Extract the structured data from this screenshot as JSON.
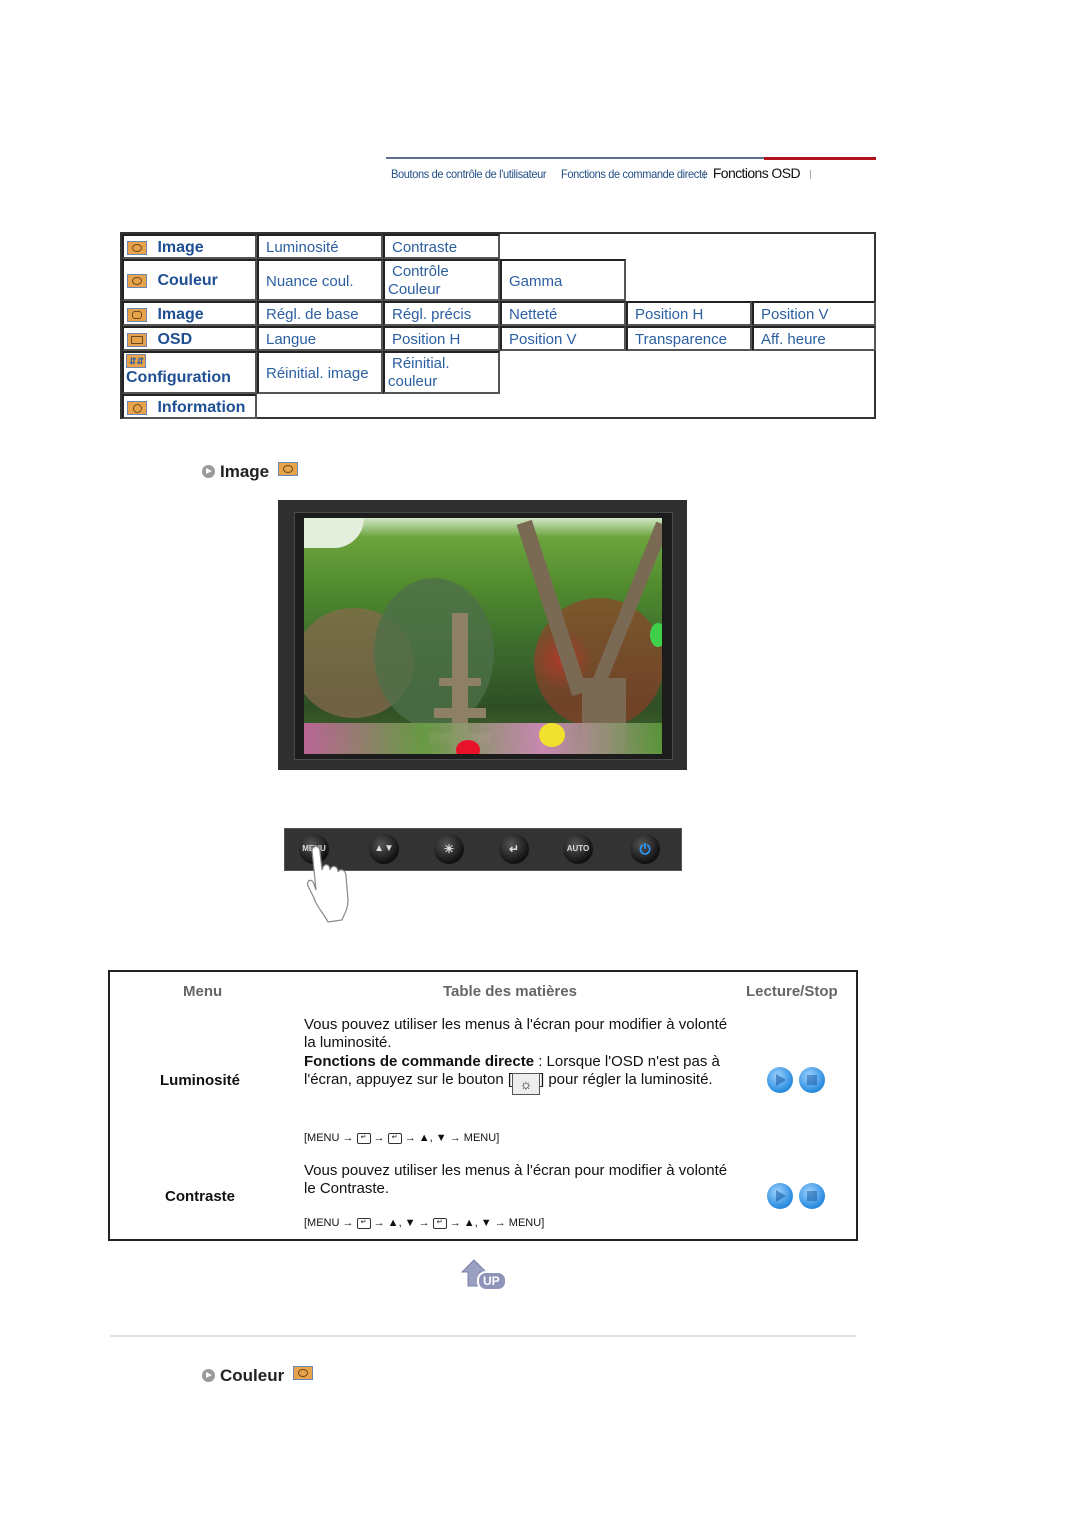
{
  "topnav": {
    "links": [
      "Boutons de contrôle de l'utilisateur",
      "Fonctions de commande directe"
    ],
    "active": "Fonctions OSD",
    "active_color": "#b0131d"
  },
  "menu_table": {
    "rows": [
      {
        "header": "Image",
        "icon": "image-icon",
        "items": [
          "Luminosité",
          "Contraste"
        ]
      },
      {
        "header": "Couleur",
        "icon": "color-icon",
        "items": [
          "Nuance coul.",
          "Contrôle Couleur",
          "Gamma"
        ]
      },
      {
        "header": "Image",
        "icon": "geometry-icon",
        "items": [
          "Régl. de base",
          "Régl. précis",
          "Netteté",
          "Position H",
          "Position V"
        ]
      },
      {
        "header": "OSD",
        "icon": "osd-icon",
        "items": [
          "Langue",
          "Position H",
          "Position V",
          "Transparence",
          "Aff. heure"
        ]
      },
      {
        "header": "Configuration",
        "icon": "setup-icon",
        "items": [
          "Réinitial. image",
          "Réinitial. couleur"
        ]
      },
      {
        "header": "Information",
        "icon": "information-icon",
        "items": []
      }
    ]
  },
  "section_image": {
    "title": "Image"
  },
  "monitor_buttons": [
    "MENU",
    "▲▼",
    "☀",
    "↵",
    "AUTO",
    "⏻"
  ],
  "content_table": {
    "headers": {
      "menu": "Menu",
      "contents": "Table des matières",
      "play": "Lecture/Stop"
    },
    "rows": [
      {
        "label": "Luminosité",
        "desc1": "Vous pouvez utiliser les menus à l'écran pour modifier à volonté la luminosité.",
        "desc_bold": "Fonctions de commande directe",
        "desc2_a": " : Lorsque l'OSD n'est pas à l'écran, appuyez sur le bouton [",
        "desc2_b": "] pour régler la luminosité.",
        "path": [
          "[MENU →",
          "↵",
          "→",
          "↵",
          "→ ▲, ▼ → MENU]"
        ]
      },
      {
        "label": "Contraste",
        "desc1": "Vous pouvez utiliser les menus à l'écran pour modifier à volonté le Contraste.",
        "path": [
          "[MENU →",
          "↵",
          "→ ▲, ▼ →",
          "↵",
          "→ ▲, ▼ → MENU]"
        ]
      }
    ]
  },
  "up_label": "UP",
  "section_couleur": {
    "title": "Couleur"
  }
}
